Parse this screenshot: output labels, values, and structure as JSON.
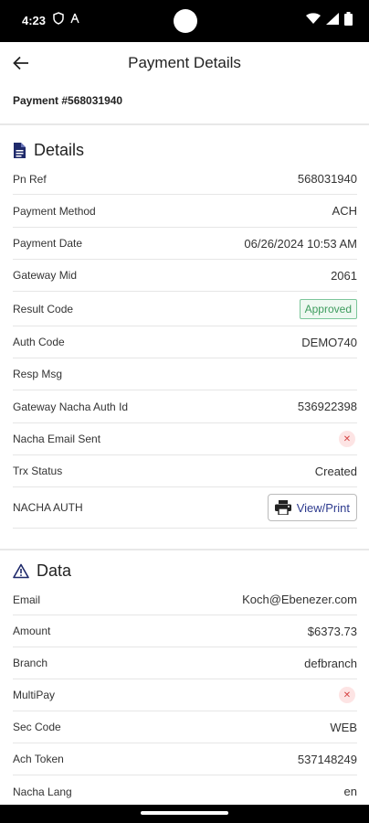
{
  "status": {
    "time": "4:23"
  },
  "appbar": {
    "title": "Payment Details"
  },
  "payment": {
    "number_label": "Payment #568031940"
  },
  "details": {
    "heading": "Details",
    "rows": [
      {
        "label": "Pn Ref",
        "value": "568031940"
      },
      {
        "label": "Payment Method",
        "value": "ACH"
      },
      {
        "label": "Payment Date",
        "value": "06/26/2024 10:53 AM"
      },
      {
        "label": "Gateway Mid",
        "value": "2061"
      },
      {
        "label": "Result Code",
        "value": "Approved"
      },
      {
        "label": "Auth Code",
        "value": "DEMO740"
      },
      {
        "label": "Resp Msg",
        "value": ""
      },
      {
        "label": "Gateway Nacha Auth Id",
        "value": "536922398"
      },
      {
        "label": "Nacha Email Sent",
        "value": "false"
      },
      {
        "label": "Trx Status",
        "value": "Created"
      },
      {
        "label": "NACHA AUTH",
        "button": "View/Print"
      }
    ]
  },
  "data_section": {
    "heading": "Data",
    "rows": [
      {
        "label": "Email",
        "value": "Koch@Ebenezer.com"
      },
      {
        "label": "Amount",
        "value": "$6373.73"
      },
      {
        "label": "Branch",
        "value": "defbranch"
      },
      {
        "label": "MultiPay",
        "value": "false"
      },
      {
        "label": "Sec Code",
        "value": "WEB"
      },
      {
        "label": "Ach Token",
        "value": "537148249"
      },
      {
        "label": "Nacha Lang",
        "value": "en"
      }
    ]
  },
  "colors": {
    "approved": "#3e9c5e",
    "error": "#d64545",
    "accent": "#2f3c8f"
  },
  "icons": {
    "details": "document-icon",
    "data": "warning-triangle-icon",
    "back": "arrow-left-icon",
    "print": "printer-icon",
    "false": "x-circle-icon"
  }
}
